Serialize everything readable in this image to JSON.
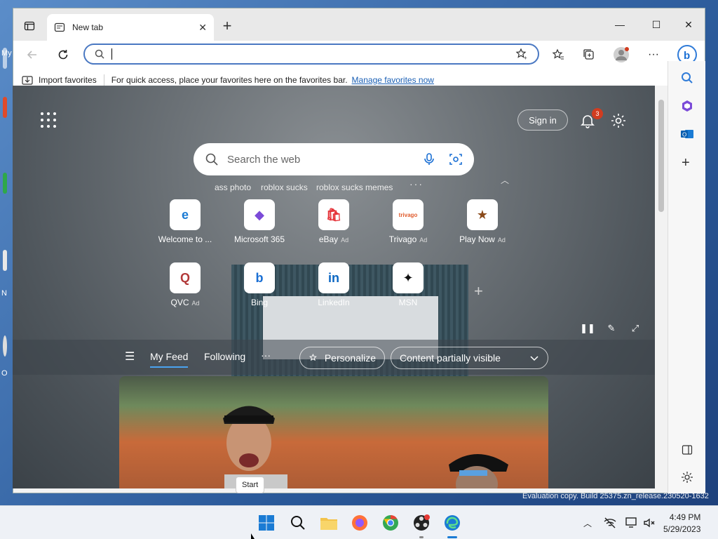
{
  "desktop": {
    "labels": [
      "My",
      "N",
      "O"
    ]
  },
  "tab": {
    "title": "New tab",
    "close": "✕"
  },
  "window_controls": {
    "minimize": "—",
    "maximize": "☐",
    "close": "✕"
  },
  "address_bar": {
    "value": "",
    "placeholder": ""
  },
  "favorites_bar": {
    "import_label": "Import favorites",
    "message": "For quick access, place your favorites here on the favorites bar.",
    "manage_link": "Manage favorites now"
  },
  "ntp": {
    "signin_label": "Sign in",
    "notification_count": "3",
    "search_placeholder": "Search the web",
    "suggestions": [
      "ass photo",
      "roblox sucks",
      "roblox sucks memes"
    ],
    "more_dots": "···",
    "tiles": [
      {
        "label": "Welcome to ...",
        "ad": "",
        "icon": "edge-icon",
        "glyph": "e",
        "color": "#1a7bd4"
      },
      {
        "label": "Microsoft 365",
        "ad": "",
        "icon": "m365-icon",
        "glyph": "◆",
        "color": "#7b4bd8"
      },
      {
        "label": "eBay",
        "ad": "Ad",
        "icon": "ebay-icon",
        "glyph": "🛍",
        "color": "#e53238"
      },
      {
        "label": "Trivago",
        "ad": "Ad",
        "icon": "trivago-icon",
        "glyph": "trivago",
        "color": "#e05a2b"
      },
      {
        "label": "Play Now",
        "ad": "Ad",
        "icon": "playnow-icon",
        "glyph": "★",
        "color": "#8a4a1a"
      },
      {
        "label": "QVC",
        "ad": "Ad",
        "icon": "qvc-icon",
        "glyph": "Q",
        "color": "#b23a3a"
      },
      {
        "label": "Bing",
        "ad": "",
        "icon": "bing-icon",
        "glyph": "b",
        "color": "#1a6fd4"
      },
      {
        "label": "LinkedIn",
        "ad": "",
        "icon": "linkedin-icon",
        "glyph": "in",
        "color": "#0a66c2"
      },
      {
        "label": "MSN",
        "ad": "",
        "icon": "msn-icon",
        "glyph": "✦",
        "color": "#111111"
      }
    ],
    "add_tile": "+"
  },
  "feed": {
    "tabs": [
      "My Feed",
      "Following"
    ],
    "more": "···",
    "personalize_label": "Personalize",
    "content_visibility": "Content partially visible"
  },
  "tooltip": {
    "text": "Start"
  },
  "watermark": {
    "text": "Evaluation copy. Build 25375.zn_release.230520-1632"
  },
  "clock": {
    "time": "4:49 PM",
    "date": "5/29/2023"
  },
  "colors": {
    "accent": "#4a78c2",
    "link": "#1a5fb4",
    "badge": "#d13c20"
  }
}
